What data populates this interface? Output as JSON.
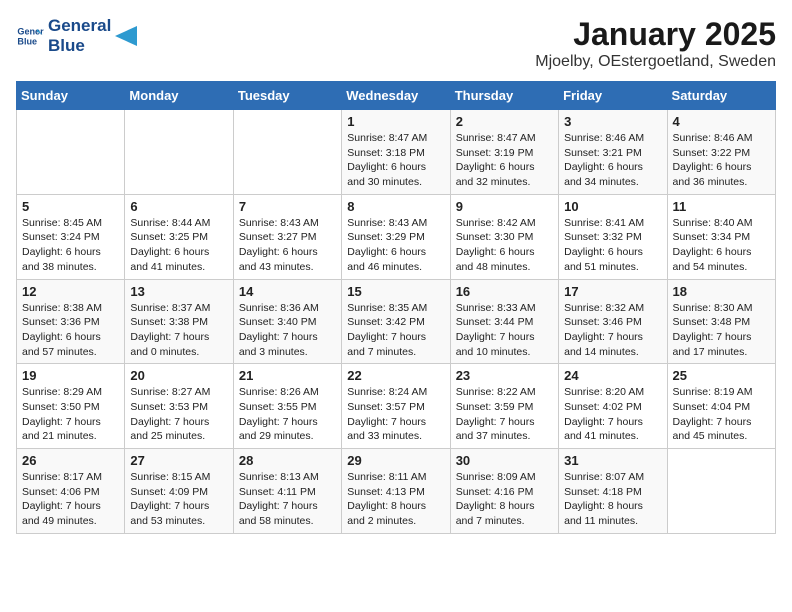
{
  "header": {
    "logo_line1": "General",
    "logo_line2": "Blue",
    "title": "January 2025",
    "subtitle": "Mjoelby, OEstergoetland, Sweden"
  },
  "weekdays": [
    "Sunday",
    "Monday",
    "Tuesday",
    "Wednesday",
    "Thursday",
    "Friday",
    "Saturday"
  ],
  "weeks": [
    [
      {
        "day": "",
        "info": ""
      },
      {
        "day": "",
        "info": ""
      },
      {
        "day": "",
        "info": ""
      },
      {
        "day": "1",
        "info": "Sunrise: 8:47 AM\nSunset: 3:18 PM\nDaylight: 6 hours\nand 30 minutes."
      },
      {
        "day": "2",
        "info": "Sunrise: 8:47 AM\nSunset: 3:19 PM\nDaylight: 6 hours\nand 32 minutes."
      },
      {
        "day": "3",
        "info": "Sunrise: 8:46 AM\nSunset: 3:21 PM\nDaylight: 6 hours\nand 34 minutes."
      },
      {
        "day": "4",
        "info": "Sunrise: 8:46 AM\nSunset: 3:22 PM\nDaylight: 6 hours\nand 36 minutes."
      }
    ],
    [
      {
        "day": "5",
        "info": "Sunrise: 8:45 AM\nSunset: 3:24 PM\nDaylight: 6 hours\nand 38 minutes."
      },
      {
        "day": "6",
        "info": "Sunrise: 8:44 AM\nSunset: 3:25 PM\nDaylight: 6 hours\nand 41 minutes."
      },
      {
        "day": "7",
        "info": "Sunrise: 8:43 AM\nSunset: 3:27 PM\nDaylight: 6 hours\nand 43 minutes."
      },
      {
        "day": "8",
        "info": "Sunrise: 8:43 AM\nSunset: 3:29 PM\nDaylight: 6 hours\nand 46 minutes."
      },
      {
        "day": "9",
        "info": "Sunrise: 8:42 AM\nSunset: 3:30 PM\nDaylight: 6 hours\nand 48 minutes."
      },
      {
        "day": "10",
        "info": "Sunrise: 8:41 AM\nSunset: 3:32 PM\nDaylight: 6 hours\nand 51 minutes."
      },
      {
        "day": "11",
        "info": "Sunrise: 8:40 AM\nSunset: 3:34 PM\nDaylight: 6 hours\nand 54 minutes."
      }
    ],
    [
      {
        "day": "12",
        "info": "Sunrise: 8:38 AM\nSunset: 3:36 PM\nDaylight: 6 hours\nand 57 minutes."
      },
      {
        "day": "13",
        "info": "Sunrise: 8:37 AM\nSunset: 3:38 PM\nDaylight: 7 hours\nand 0 minutes."
      },
      {
        "day": "14",
        "info": "Sunrise: 8:36 AM\nSunset: 3:40 PM\nDaylight: 7 hours\nand 3 minutes."
      },
      {
        "day": "15",
        "info": "Sunrise: 8:35 AM\nSunset: 3:42 PM\nDaylight: 7 hours\nand 7 minutes."
      },
      {
        "day": "16",
        "info": "Sunrise: 8:33 AM\nSunset: 3:44 PM\nDaylight: 7 hours\nand 10 minutes."
      },
      {
        "day": "17",
        "info": "Sunrise: 8:32 AM\nSunset: 3:46 PM\nDaylight: 7 hours\nand 14 minutes."
      },
      {
        "day": "18",
        "info": "Sunrise: 8:30 AM\nSunset: 3:48 PM\nDaylight: 7 hours\nand 17 minutes."
      }
    ],
    [
      {
        "day": "19",
        "info": "Sunrise: 8:29 AM\nSunset: 3:50 PM\nDaylight: 7 hours\nand 21 minutes."
      },
      {
        "day": "20",
        "info": "Sunrise: 8:27 AM\nSunset: 3:53 PM\nDaylight: 7 hours\nand 25 minutes."
      },
      {
        "day": "21",
        "info": "Sunrise: 8:26 AM\nSunset: 3:55 PM\nDaylight: 7 hours\nand 29 minutes."
      },
      {
        "day": "22",
        "info": "Sunrise: 8:24 AM\nSunset: 3:57 PM\nDaylight: 7 hours\nand 33 minutes."
      },
      {
        "day": "23",
        "info": "Sunrise: 8:22 AM\nSunset: 3:59 PM\nDaylight: 7 hours\nand 37 minutes."
      },
      {
        "day": "24",
        "info": "Sunrise: 8:20 AM\nSunset: 4:02 PM\nDaylight: 7 hours\nand 41 minutes."
      },
      {
        "day": "25",
        "info": "Sunrise: 8:19 AM\nSunset: 4:04 PM\nDaylight: 7 hours\nand 45 minutes."
      }
    ],
    [
      {
        "day": "26",
        "info": "Sunrise: 8:17 AM\nSunset: 4:06 PM\nDaylight: 7 hours\nand 49 minutes."
      },
      {
        "day": "27",
        "info": "Sunrise: 8:15 AM\nSunset: 4:09 PM\nDaylight: 7 hours\nand 53 minutes."
      },
      {
        "day": "28",
        "info": "Sunrise: 8:13 AM\nSunset: 4:11 PM\nDaylight: 7 hours\nand 58 minutes."
      },
      {
        "day": "29",
        "info": "Sunrise: 8:11 AM\nSunset: 4:13 PM\nDaylight: 8 hours\nand 2 minutes."
      },
      {
        "day": "30",
        "info": "Sunrise: 8:09 AM\nSunset: 4:16 PM\nDaylight: 8 hours\nand 7 minutes."
      },
      {
        "day": "31",
        "info": "Sunrise: 8:07 AM\nSunset: 4:18 PM\nDaylight: 8 hours\nand 11 minutes."
      },
      {
        "day": "",
        "info": ""
      }
    ]
  ]
}
